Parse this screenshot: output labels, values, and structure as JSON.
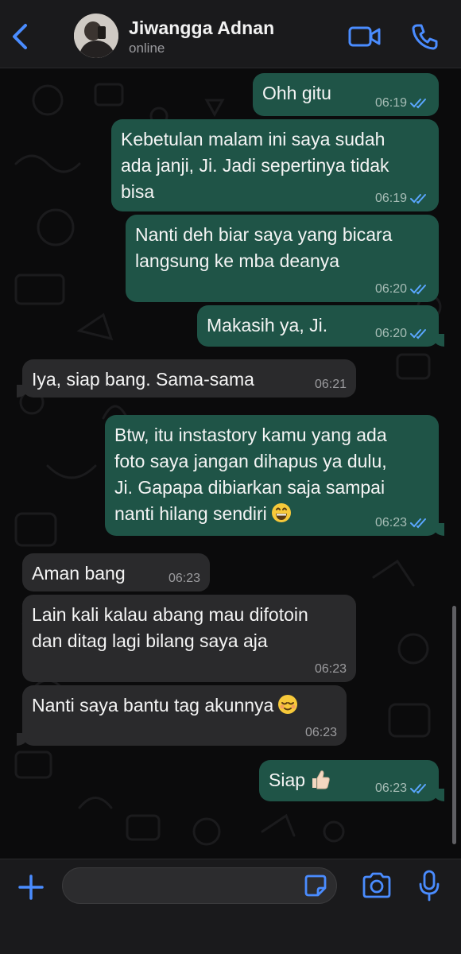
{
  "header": {
    "contact_name": "Jiwangga Adnan",
    "status": "online",
    "icons": [
      "back-chevron-icon",
      "avatar",
      "video-camera-icon",
      "phone-icon"
    ]
  },
  "colors": {
    "accent": "#4a8cff",
    "outgoing_bubble": "#1f5447",
    "incoming_bubble": "#2a2a2c",
    "read_tick": "#5aa7ff"
  },
  "messages": [
    {
      "dir": "out",
      "text": "Ohh gitu",
      "time": "06:19",
      "read": true
    },
    {
      "dir": "out",
      "text": "Kebetulan malam ini saya sudah\nada janji, Ji. Jadi sepertinya tidak\nbisa",
      "time": "06:19",
      "read": true
    },
    {
      "dir": "out",
      "text": "Nanti deh biar saya yang bicara\nlangsung ke mba deanya",
      "time": "06:20",
      "read": true
    },
    {
      "dir": "out",
      "text": "Makasih ya, Ji.",
      "time": "06:20",
      "read": true
    },
    {
      "dir": "in",
      "text": "Iya, siap bang. Sama-sama",
      "time": "06:21"
    },
    {
      "dir": "out",
      "text": "Btw, itu instastory kamu yang ada\nfoto saya jangan dihapus ya dulu,\nJi. Gapapa dibiarkan saja sampai\nnanti hilang sendiri",
      "emoji": "grinning-face-emoji",
      "time": "06:23",
      "read": true
    },
    {
      "dir": "in",
      "text": "Aman bang",
      "time": "06:23"
    },
    {
      "dir": "in",
      "text": "Lain kali kalau abang mau difotoin\ndan ditag lagi bilang saya aja",
      "time": "06:23"
    },
    {
      "dir": "in",
      "text": "Nanti saya bantu tag akunnya",
      "emoji": "relieved-face-emoji",
      "time": "06:23"
    },
    {
      "dir": "out",
      "text": "Siap",
      "emoji": "thumbs-up-emoji",
      "time": "06:23",
      "read": true
    }
  ],
  "input": {
    "value": "",
    "placeholder": "",
    "icons": [
      "plus-icon",
      "sticker-icon",
      "camera-icon",
      "microphone-icon"
    ]
  }
}
